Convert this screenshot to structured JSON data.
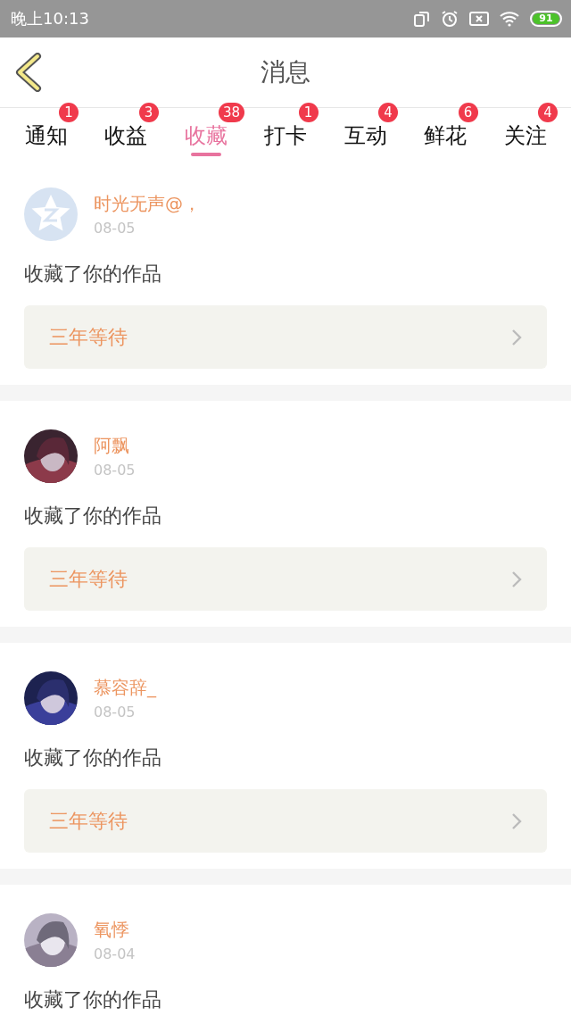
{
  "status_bar": {
    "time": "晚上10:13",
    "battery": "91"
  },
  "header": {
    "title": "消息"
  },
  "tabs": [
    {
      "label": "通知",
      "badge": "1",
      "selected": false
    },
    {
      "label": "收益",
      "badge": "3",
      "selected": false
    },
    {
      "label": "收藏",
      "badge": "38",
      "selected": true
    },
    {
      "label": "打卡",
      "badge": "1",
      "selected": false
    },
    {
      "label": "互动",
      "badge": "4",
      "selected": false
    },
    {
      "label": "鲜花",
      "badge": "6",
      "selected": false
    },
    {
      "label": "关注",
      "badge": "4",
      "selected": false
    }
  ],
  "messages": [
    {
      "avatar": {
        "kind": "default"
      },
      "name": "时光无声@，",
      "date": "08-05",
      "text": "收藏了你的作品",
      "link": "三年等待"
    },
    {
      "name": "阿飘",
      "date": "08-05",
      "text": "收藏了你的作品",
      "link": "三年等待"
    },
    {
      "name": "慕容辞_",
      "date": "08-05",
      "text": "收藏了你的作品",
      "link": "三年等待"
    },
    {
      "name": "氧悸",
      "date": "08-04",
      "text": "收藏了你的作品"
    }
  ]
}
